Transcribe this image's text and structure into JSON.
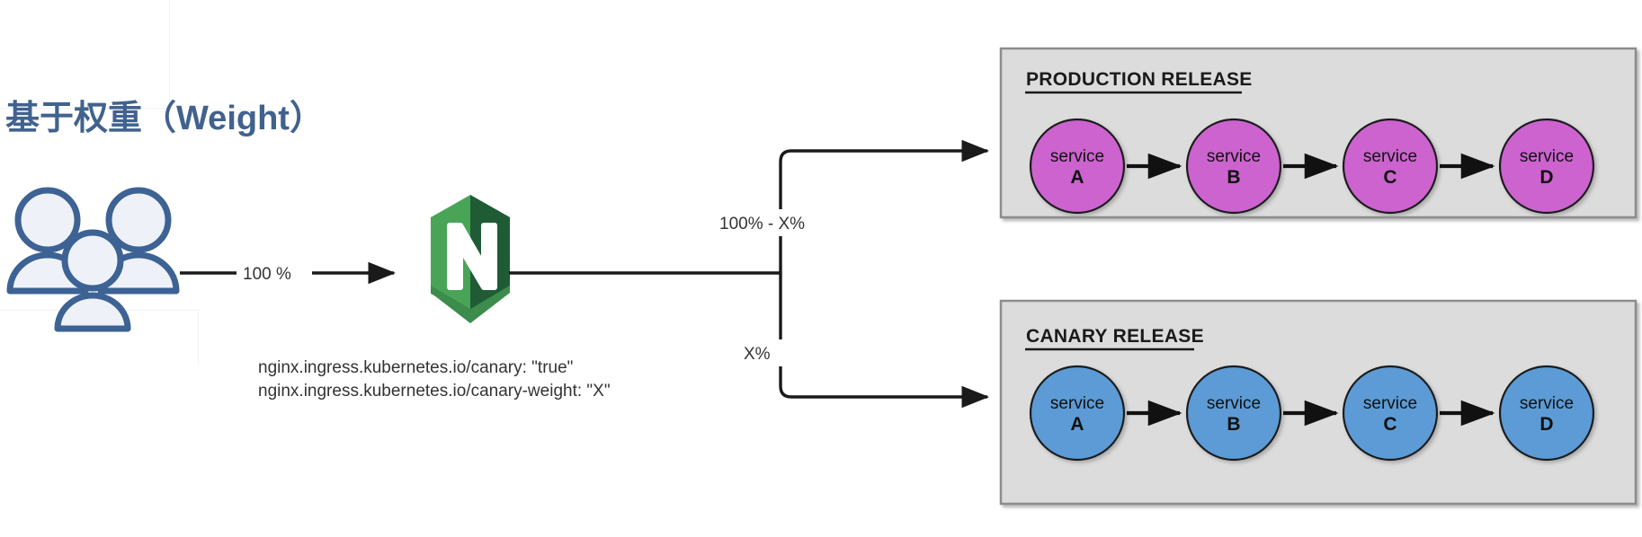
{
  "title": "基于权重（Weight）",
  "colors": {
    "title": "#41628e",
    "user_icon_stroke": "#3d6294",
    "user_icon_fill": "#eef1f7",
    "nginx_light": "#4aa457",
    "nginx_dark": "#1f5c36",
    "nginx_mid": "#3c8c4c",
    "production_circle": "#cc63cf",
    "canary_circle": "#5b9bd5",
    "box_bg": "#dcdcdc",
    "box_border": "#8c8c8c",
    "line": "#1a1a1a"
  },
  "flow": {
    "users_icon": "users-icon",
    "ingress_icon": "nginx-logo",
    "incoming_label": "100 %",
    "branch_top_label": "100% - X%",
    "branch_bottom_label": "X%",
    "annotations": [
      "nginx.ingress.kubernetes.io/canary: \"true\"",
      "nginx.ingress.kubernetes.io/canary-weight: \"X\""
    ]
  },
  "groups": [
    {
      "id": "production",
      "label": "PRODUCTION RELEASE",
      "color": "#cc63cf",
      "services": [
        {
          "kind": "service",
          "name": "A"
        },
        {
          "kind": "service",
          "name": "B"
        },
        {
          "kind": "service",
          "name": "C"
        },
        {
          "kind": "service",
          "name": "D"
        }
      ]
    },
    {
      "id": "canary",
      "label": "CANARY RELEASE",
      "color": "#5b9bd5",
      "services": [
        {
          "kind": "service",
          "name": "A"
        },
        {
          "kind": "service",
          "name": "B"
        },
        {
          "kind": "service",
          "name": "C"
        },
        {
          "kind": "service",
          "name": "D"
        }
      ]
    }
  ]
}
